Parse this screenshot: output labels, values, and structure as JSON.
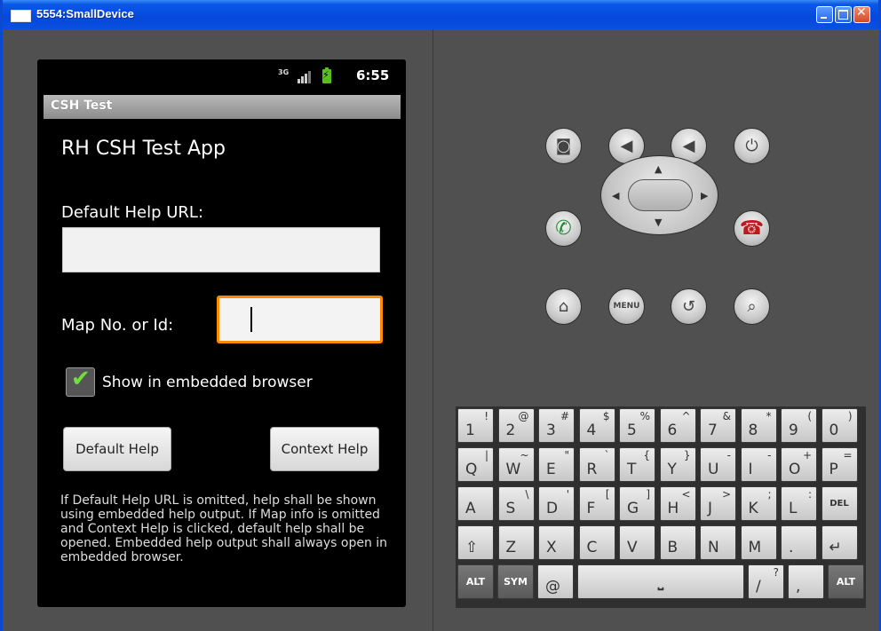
{
  "window": {
    "title": "5554:SmallDevice"
  },
  "statusbar": {
    "network": "3G",
    "time": "6:55"
  },
  "app": {
    "title_bar": "CSH Test",
    "heading": "RH CSH Test App",
    "default_url_label": "Default Help URL:",
    "default_url_value": "",
    "map_label": "Map No. or Id:",
    "map_value": "",
    "checkbox_label": "Show in embedded browser",
    "checkbox_checked": true,
    "default_help_button": "Default Help",
    "context_help_button": "Context Help",
    "note": "If Default Help URL is omitted, help shall be shown using embedded help output. If Map info is omitted and Context Help is clicked, default help shall be opened. Embedded help output shall always open in embedded browser."
  },
  "controls": {
    "row1": [
      {
        "name": "camera-icon"
      },
      {
        "name": "volume-down-icon"
      },
      {
        "name": "volume-up-icon"
      },
      {
        "name": "power-icon"
      }
    ],
    "row2": [
      {
        "name": "call-icon"
      },
      {
        "name": "dpad"
      },
      {
        "name": "end-call-icon"
      }
    ],
    "row3": [
      {
        "name": "home-icon"
      },
      {
        "name": "menu-button",
        "label": "MENU"
      },
      {
        "name": "back-icon"
      },
      {
        "name": "search-icon"
      }
    ]
  },
  "keyboard": {
    "row1": [
      [
        "1",
        "!"
      ],
      [
        "2",
        "@"
      ],
      [
        "3",
        "#"
      ],
      [
        "4",
        "$"
      ],
      [
        "5",
        "%"
      ],
      [
        "6",
        "^"
      ],
      [
        "7",
        "&"
      ],
      [
        "8",
        "*"
      ],
      [
        "9",
        "("
      ],
      [
        "0",
        ")"
      ]
    ],
    "row2": [
      [
        "Q",
        "|"
      ],
      [
        "W",
        "~"
      ],
      [
        "E",
        "\""
      ],
      [
        "R",
        "`"
      ],
      [
        "T",
        "{"
      ],
      [
        "Y",
        "}"
      ],
      [
        "U",
        "-"
      ],
      [
        "I",
        "-"
      ],
      [
        "O",
        "+"
      ],
      [
        "P",
        "="
      ]
    ],
    "row3": [
      [
        "A",
        ""
      ],
      [
        "S",
        "\\"
      ],
      [
        "D",
        "'"
      ],
      [
        "F",
        "["
      ],
      [
        "G",
        "]"
      ],
      [
        "H",
        "<"
      ],
      [
        "J",
        ">"
      ],
      [
        "K",
        ";"
      ],
      [
        "L",
        ":"
      ],
      [
        "DEL",
        ""
      ]
    ],
    "row4": [
      [
        "⇧",
        ""
      ],
      [
        "Z",
        ""
      ],
      [
        "X",
        ""
      ],
      [
        "C",
        ""
      ],
      [
        "V",
        ""
      ],
      [
        "B",
        ""
      ],
      [
        "N",
        ""
      ],
      [
        "M",
        ""
      ],
      [
        ".",
        ""
      ],
      [
        "↵",
        ""
      ]
    ],
    "row5": [
      [
        "ALT",
        ""
      ],
      [
        "SYM",
        ""
      ],
      [
        "@",
        ""
      ],
      [
        "space",
        ""
      ],
      [
        "/",
        "?"
      ],
      [
        ",",
        ""
      ],
      [
        "ALT",
        ""
      ]
    ]
  }
}
